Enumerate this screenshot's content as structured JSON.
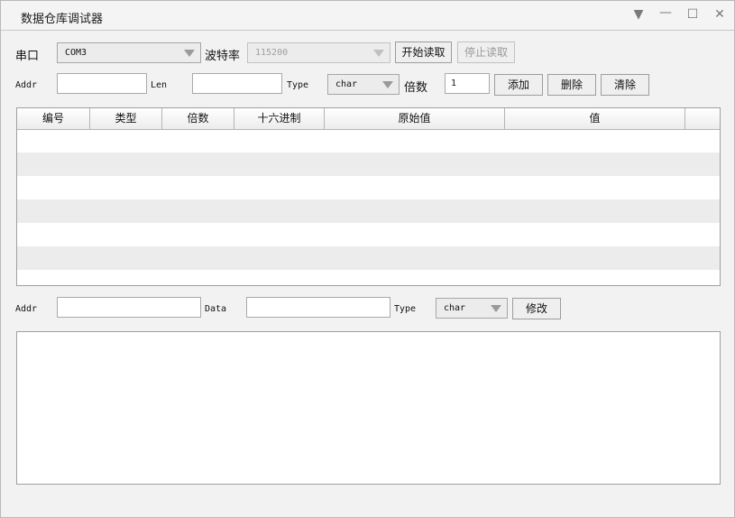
{
  "window": {
    "title": "数据仓库调试器",
    "menu_glyph": "▼",
    "min_glyph": "—",
    "max_glyph": "☐",
    "close_glyph": "✕"
  },
  "serial": {
    "port_label": "串口",
    "port_value": "COM3",
    "baud_label": "波特率",
    "baud_value": "115200",
    "start_label": "开始读取",
    "stop_label": "停止读取"
  },
  "query": {
    "addr_label": "Addr",
    "addr_value": "",
    "len_label": "Len",
    "len_value": "",
    "type_label": "Type",
    "type_value": "char",
    "multiplier_label": "倍数",
    "multiplier_value": "1",
    "add_label": "添加",
    "delete_label": "删除",
    "clear_label": "清除"
  },
  "table": {
    "columns": [
      "编号",
      "类型",
      "倍数",
      "十六进制",
      "原始值",
      "值"
    ],
    "rows": []
  },
  "write": {
    "addr_label": "Addr",
    "addr_value": "",
    "data_label": "Data",
    "data_value": "",
    "type_label": "Type",
    "type_value": "char",
    "modify_label": "修改"
  },
  "log": {
    "text": ""
  }
}
